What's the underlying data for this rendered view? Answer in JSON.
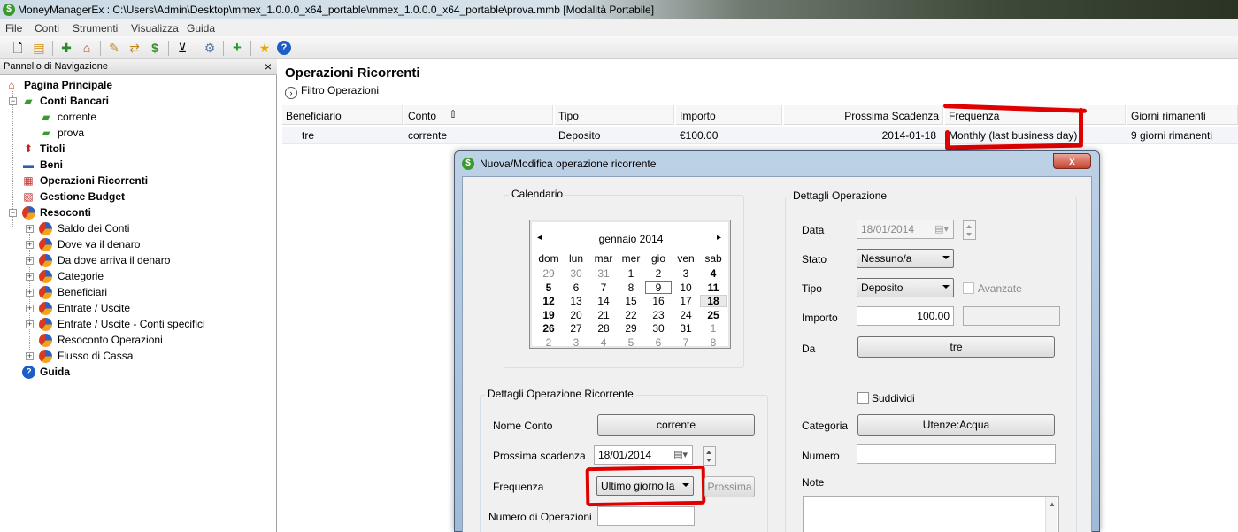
{
  "window": {
    "title": "MoneyManagerEx : C:\\Users\\Admin\\Desktop\\mmex_1.0.0.0_x64_portable\\mmex_1.0.0.0_x64_portable\\prova.mmb [Modalità Portabile]"
  },
  "menu": [
    "File",
    "Conti",
    "Strumenti",
    "Visualizza",
    "Guida"
  ],
  "toolbar_icons": [
    "new-database-icon",
    "open-database-icon",
    "new-account-icon",
    "home-icon",
    "edit-icon",
    "transfer-icon",
    "currency-icon",
    "filter-icon",
    "settings-icon",
    "add-icon",
    "favorite-icon",
    "help-icon"
  ],
  "nav": {
    "header": "Pannello di Navigazione",
    "items": [
      {
        "label": "Pagina Principale",
        "bold": true
      },
      {
        "label": "Conti Bancari",
        "bold": true
      },
      {
        "label": "corrente"
      },
      {
        "label": "prova"
      },
      {
        "label": "Titoli",
        "bold": true
      },
      {
        "label": "Beni",
        "bold": true
      },
      {
        "label": "Operazioni Ricorrenti",
        "bold": true
      },
      {
        "label": "Gestione Budget",
        "bold": true
      },
      {
        "label": "Resoconti",
        "bold": true
      },
      {
        "label": "Saldo dei Conti"
      },
      {
        "label": "Dove va il denaro"
      },
      {
        "label": "Da dove arriva il denaro"
      },
      {
        "label": "Categorie"
      },
      {
        "label": "Beneficiari"
      },
      {
        "label": "Entrate / Uscite"
      },
      {
        "label": "Entrate / Uscite - Conti specifici"
      },
      {
        "label": "Resoconto Operazioni"
      },
      {
        "label": "Flusso di Cassa"
      },
      {
        "label": "Guida",
        "bold": true
      }
    ]
  },
  "main": {
    "title": "Operazioni Ricorrenti",
    "filter_label": "Filtro Operazioni",
    "columns": [
      "Beneficiario",
      "Conto",
      "Tipo",
      "Importo",
      "Prossima Scadenza",
      "Frequenza",
      "Giorni rimanenti"
    ],
    "rows": [
      {
        "beneficiario": "tre",
        "conto": "corrente",
        "tipo": "Deposito",
        "importo": "€100.00",
        "scadenza": "2014-01-18",
        "frequenza": "Monthly (last business day)",
        "giorni": "9 giorni rimanenti"
      }
    ]
  },
  "dialog": {
    "title": "Nuova/Modifica operazione ricorrente",
    "close": "x",
    "calendar_group": "Calendario",
    "calendar": {
      "month_label": "gennaio 2014",
      "prev": "◂",
      "next": "▸",
      "weekdays": [
        "dom",
        "lun",
        "mar",
        "mer",
        "gio",
        "ven",
        "sab"
      ],
      "weeks": [
        [
          "29",
          "30",
          "31",
          "1",
          "2",
          "3",
          "4"
        ],
        [
          "5",
          "6",
          "7",
          "8",
          "9",
          "10",
          "11"
        ],
        [
          "12",
          "13",
          "14",
          "15",
          "16",
          "17",
          "18"
        ],
        [
          "19",
          "20",
          "21",
          "22",
          "23",
          "24",
          "25"
        ],
        [
          "26",
          "27",
          "28",
          "29",
          "30",
          "31",
          "1"
        ],
        [
          "2",
          "3",
          "4",
          "5",
          "6",
          "7",
          "8"
        ]
      ]
    },
    "recurring_group": "Dettagli Operazione Ricorrente",
    "account_label": "Nome Conto",
    "account_value": "corrente",
    "next_due_label": "Prossima scadenza",
    "next_due_value": "18/01/2014",
    "frequency_label": "Frequenza",
    "frequency_value": "Ultimo giorno la",
    "next_button": "Prossima",
    "num_ops_label": "Numero di Operazioni",
    "num_ops_value": "",
    "details_group": "Dettagli Operazione",
    "date_label": "Data",
    "date_value": "18/01/2014",
    "status_label": "Stato",
    "status_value": "Nessuno/a",
    "type_label": "Tipo",
    "type_value": "Deposito",
    "advanced_label": "Avanzate",
    "amount_label": "Importo",
    "amount_value": "100.00",
    "amount2_value": "",
    "from_label": "Da",
    "from_value": "tre",
    "split_label": "Suddividi",
    "category_label": "Categoria",
    "category_value": "Utenze:Acqua",
    "number_label": "Numero",
    "number_value": "",
    "notes_label": "Note",
    "notes_value": ""
  }
}
